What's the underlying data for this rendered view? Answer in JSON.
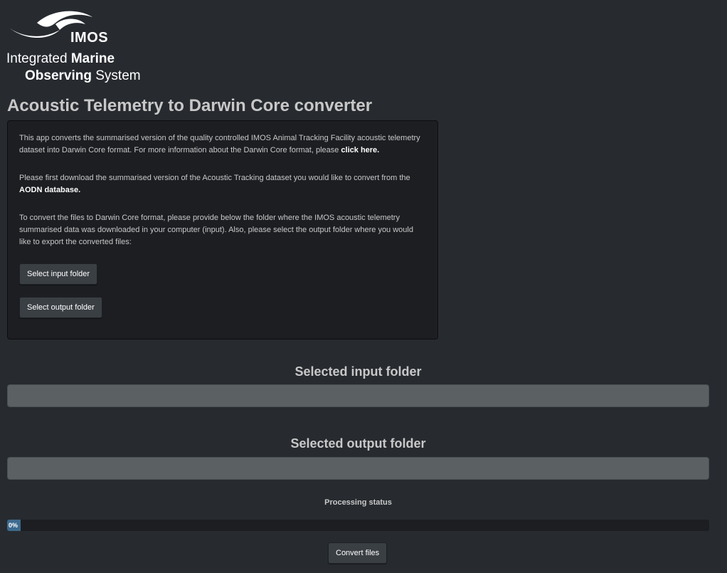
{
  "logo": {
    "acronym": "IMOS",
    "line1_light": "Integrated ",
    "line1_bold": "Marine",
    "line2_bold": "Observing",
    "line2_light": " System"
  },
  "title": "Acoustic Telemetry to Darwin Core converter",
  "info": {
    "p1_text": "This app converts the summarised version of the quality controlled IMOS Animal Tracking Facility acoustic telemetry dataset into Darwin Core format. For more information about the Darwin Core format, please ",
    "p1_link": "click here.",
    "p2_text": "Please first download the summarised version of the Acoustic Tracking dataset you would like to convert from the ",
    "p2_link": "AODN database.",
    "p3_text": "To convert the files to Darwin Core format, please provide below the folder where the IMOS acoustic telemetry summarised data was downloaded in your computer (input). Also, please select the output folder where you would like to export the converted files:",
    "select_input_label": "Select input folder",
    "select_output_label": "Select output folder"
  },
  "input_section": {
    "heading": "Selected input folder",
    "value": ""
  },
  "output_section": {
    "heading": "Selected output folder",
    "value": ""
  },
  "processing": {
    "label": "Processing status",
    "progress_text": "0%",
    "progress_fraction": 0
  },
  "convert_label": "Convert files",
  "colors": {
    "background": "#272b30",
    "panel": "#1c1e22",
    "progress_fill": "#3d6a8e",
    "field": "#5b6063"
  }
}
